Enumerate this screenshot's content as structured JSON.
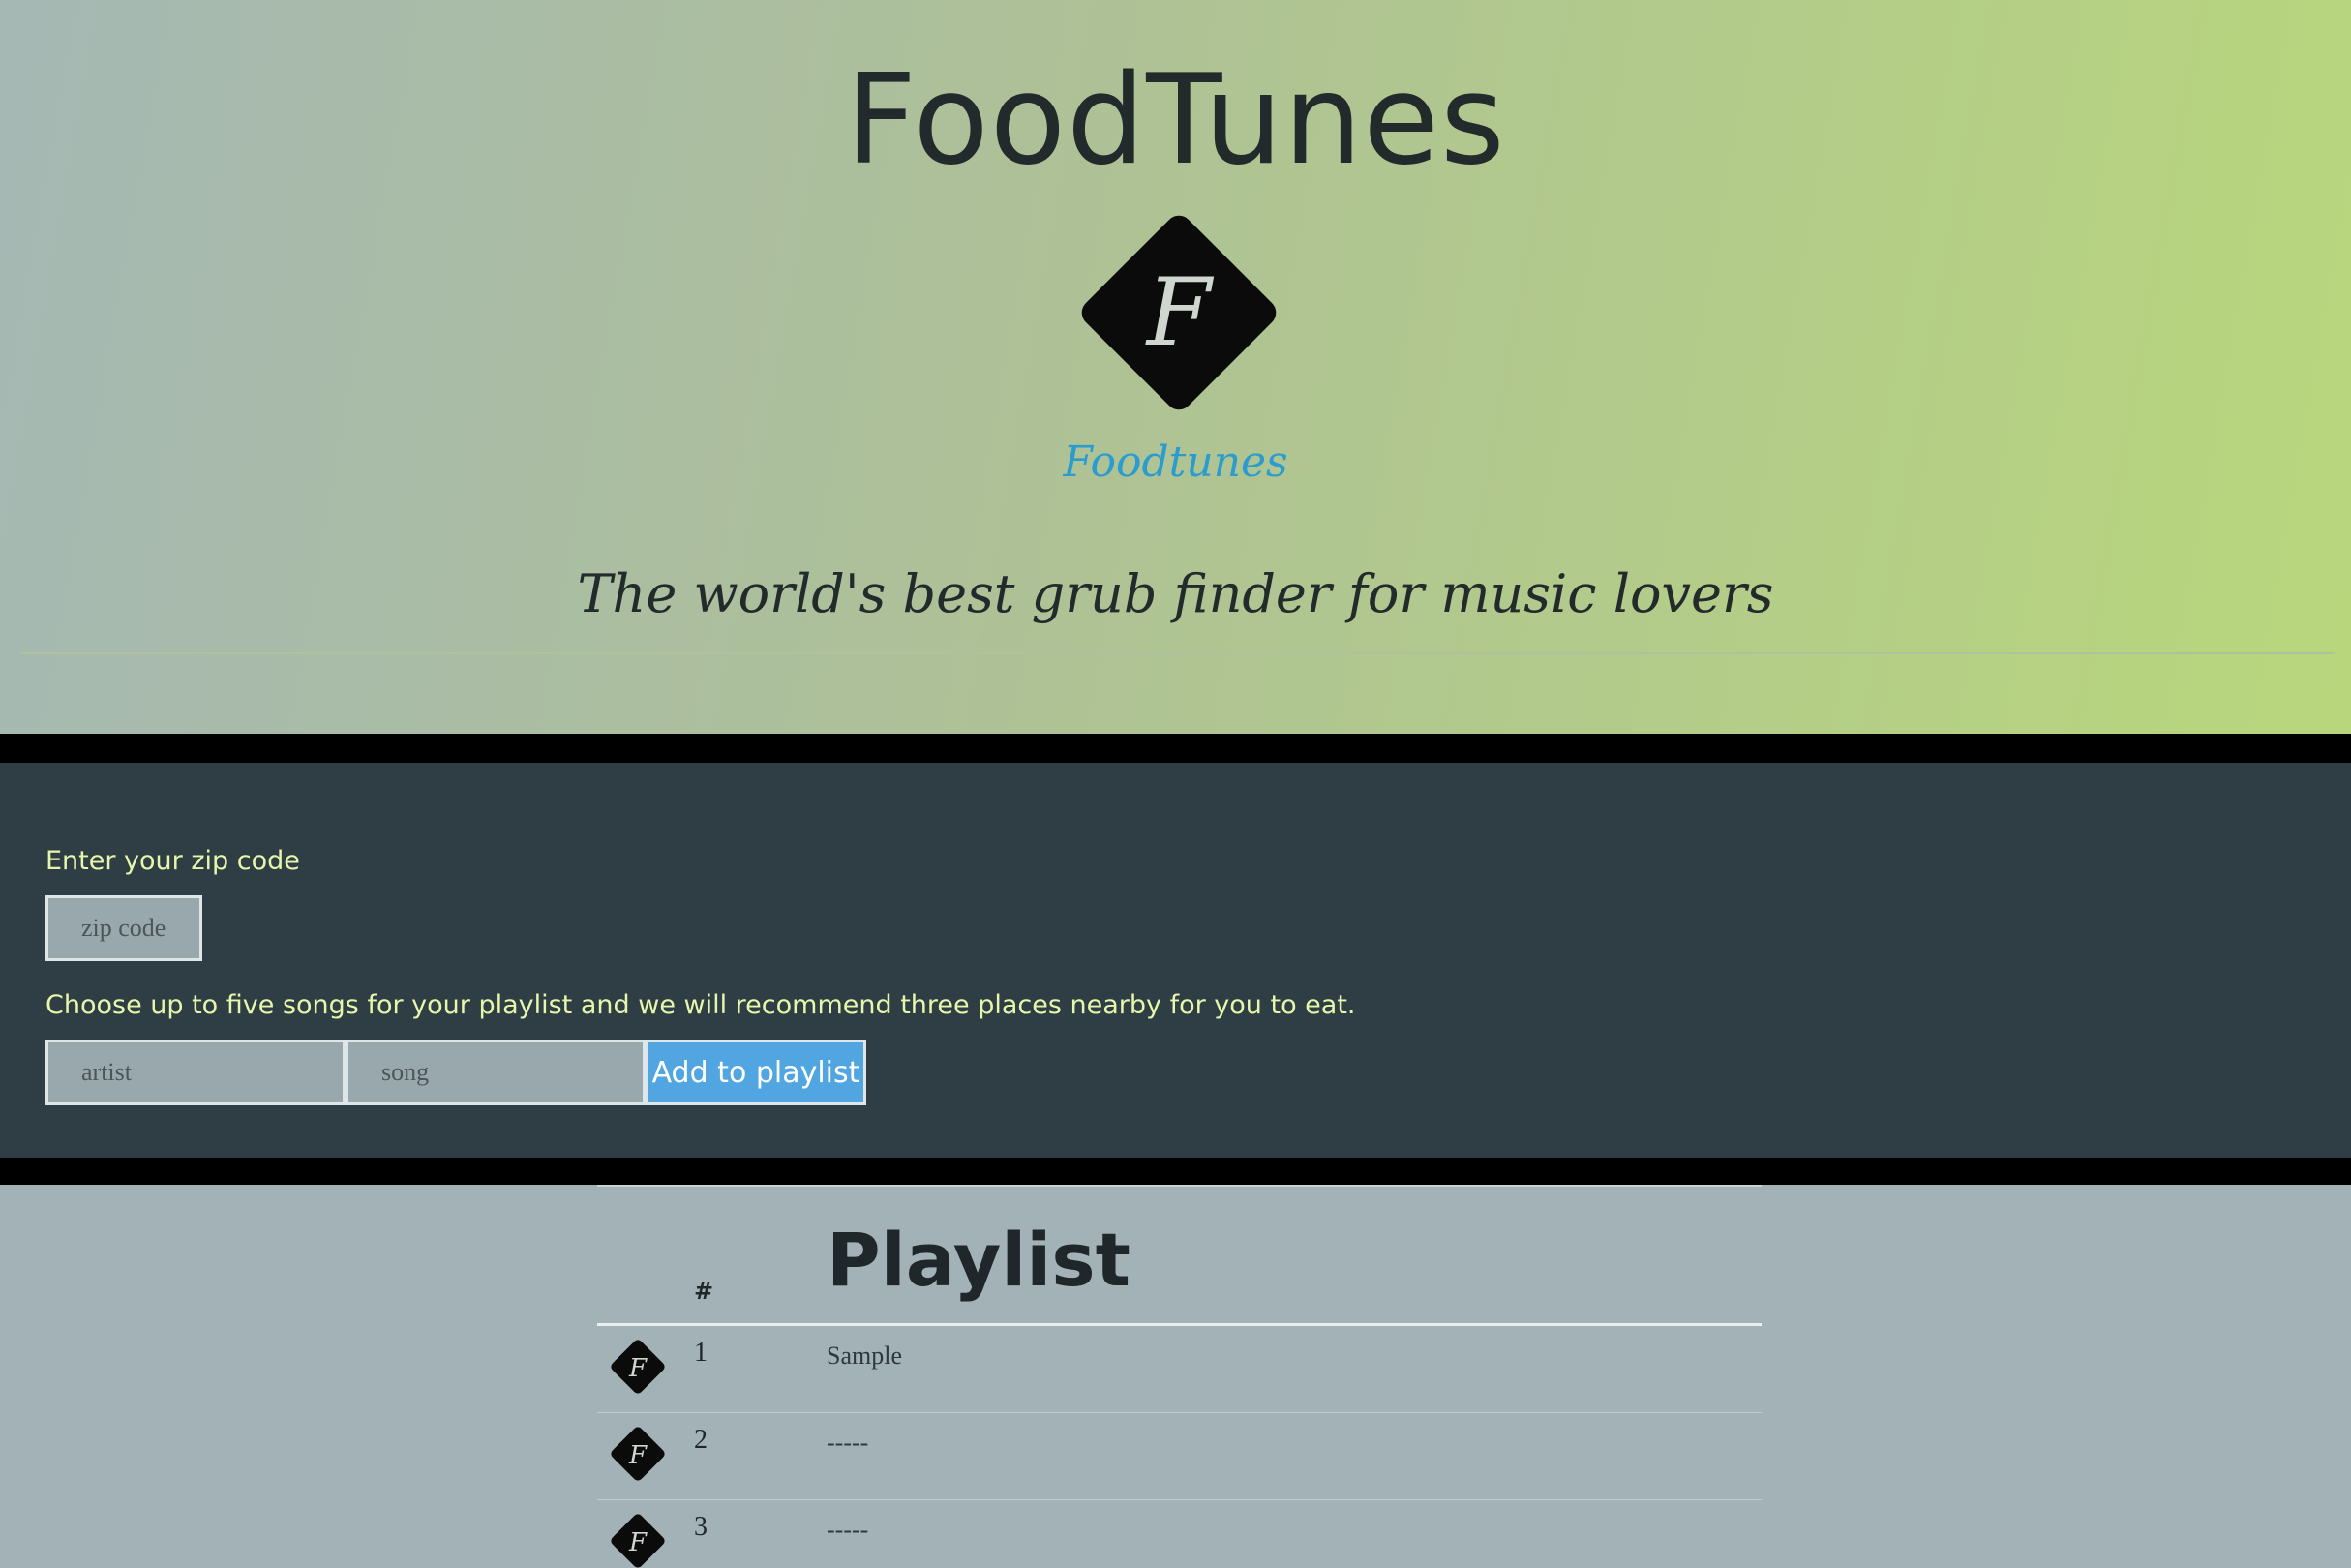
{
  "header": {
    "title": "FoodTunes",
    "logo_letter": "F",
    "logo_wordmark": "Foodtunes",
    "tagline": "The world's best grub finder for music lovers"
  },
  "form": {
    "zip_label": "Enter your zip code",
    "zip_placeholder": "zip code",
    "songs_label": "Choose up to five songs for your playlist and we will recommend three places nearby for you to eat.",
    "artist_placeholder": "artist",
    "song_placeholder": "song",
    "add_button_label": "Add to playlist"
  },
  "playlist": {
    "title": "Playlist",
    "number_header": "#",
    "rows": [
      {
        "number": "1",
        "song": "Sample"
      },
      {
        "number": "2",
        "song": "-----"
      },
      {
        "number": "3",
        "song": "-----"
      }
    ]
  },
  "colors": {
    "accent_button": "#51a6e2",
    "label_text": "#e6f7ac",
    "panel_bg": "#2f3e45",
    "wordmark": "#2b9ccf"
  }
}
